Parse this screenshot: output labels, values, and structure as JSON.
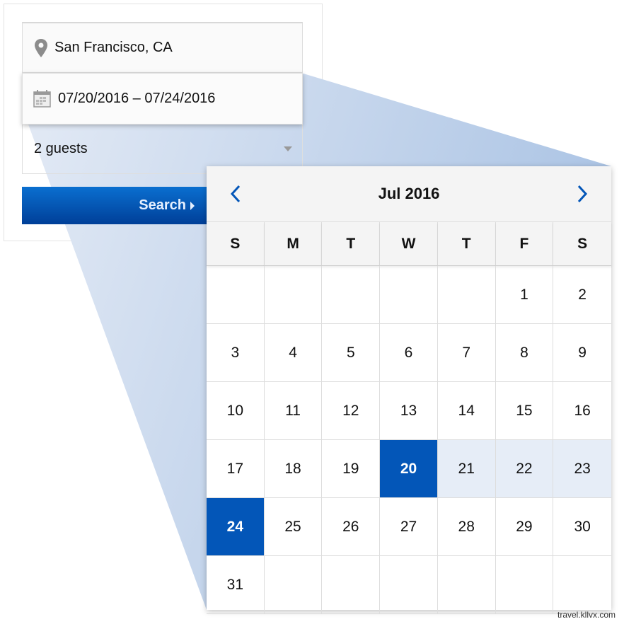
{
  "search_form": {
    "location_icon": "map-pin-icon",
    "location_value": "San Francisco, CA",
    "date_icon": "calendar-icon",
    "date_value": "07/20/2016 – 07/24/2016",
    "guests_value": "2 guests",
    "search_label": "Search"
  },
  "calendar": {
    "month_label": "Jul 2016",
    "weekdays": [
      "S",
      "M",
      "T",
      "W",
      "T",
      "F",
      "S"
    ],
    "leading_blanks": 5,
    "days": [
      "1",
      "2",
      "3",
      "4",
      "5",
      "6",
      "7",
      "8",
      "9",
      "10",
      "11",
      "12",
      "13",
      "14",
      "15",
      "16",
      "17",
      "18",
      "19",
      "20",
      "21",
      "22",
      "23",
      "24",
      "25",
      "26",
      "27",
      "28",
      "29",
      "30",
      "31"
    ],
    "selected_start": "20",
    "selected_end": "24",
    "in_range": [
      "21",
      "22",
      "23"
    ],
    "accent_color": "#0356b8",
    "range_color": "#e6edf7"
  },
  "watermark": "travel.kllvx.com"
}
